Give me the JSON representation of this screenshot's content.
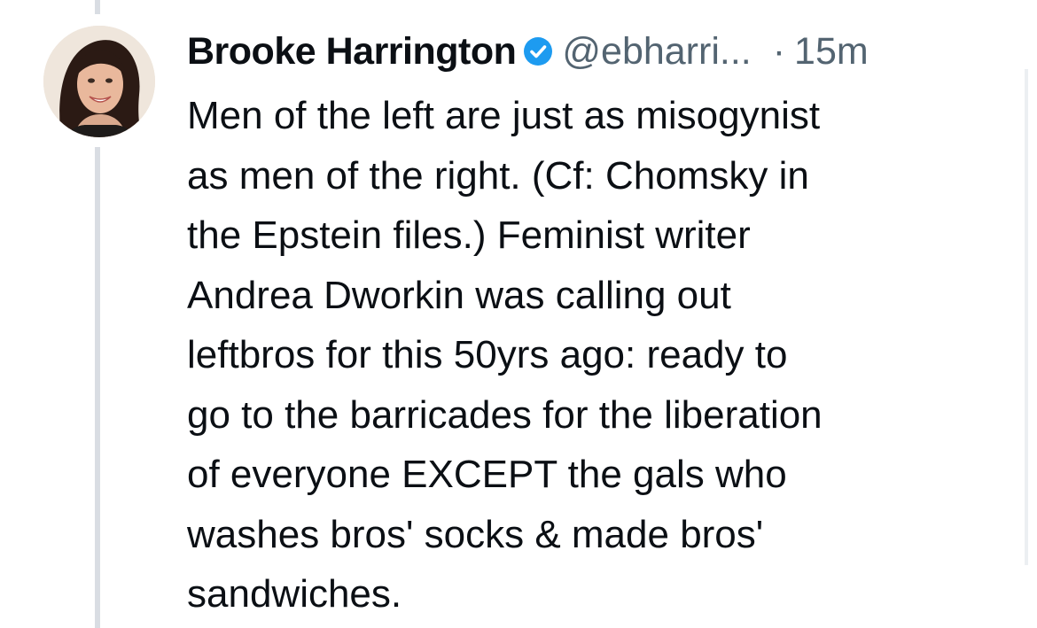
{
  "post": {
    "author": {
      "display_name": "Brooke Harrington",
      "verified": true,
      "handle": "@ebharri...",
      "avatar_icon": "profile-photo"
    },
    "separator": "·",
    "timestamp": "15m",
    "text": "Men of the left are just as misogynist\nas men of the right. (Cf: Chomsky in\nthe Epstein files.) Feminist writer\nAndrea Dworkin was calling out\nleftbros for this 50yrs ago: ready to\ngo to the barricades for the liberation\nof everyone EXCEPT the gals who\nwashes bros' socks & made bros'\nsandwiches."
  },
  "colors": {
    "verified_badge": "#1d9bf0",
    "muted_text": "#536471",
    "thread_line": "#d9dde3"
  }
}
